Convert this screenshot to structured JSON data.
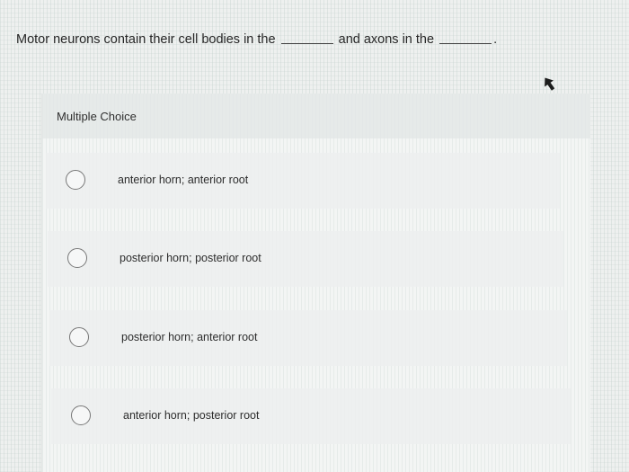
{
  "question": {
    "part1": "Motor neurons contain their cell bodies in the",
    "part2": "and axons in the",
    "end": "."
  },
  "multiple_choice": {
    "title": "Multiple Choice",
    "options": [
      {
        "label": "anterior horn; anterior root",
        "selected": false
      },
      {
        "label": "posterior horn; posterior root",
        "selected": false
      },
      {
        "label": "posterior horn; anterior root",
        "selected": false
      },
      {
        "label": "anterior horn; posterior root",
        "selected": false
      }
    ]
  },
  "icons": {
    "cursor": "mouse-pointer-icon",
    "radio": "radio-unselected-icon"
  },
  "colors": {
    "background": "#eef0ef",
    "panel": "#f3f5f4",
    "text": "#2b2b2b",
    "radio_border": "#777777"
  }
}
